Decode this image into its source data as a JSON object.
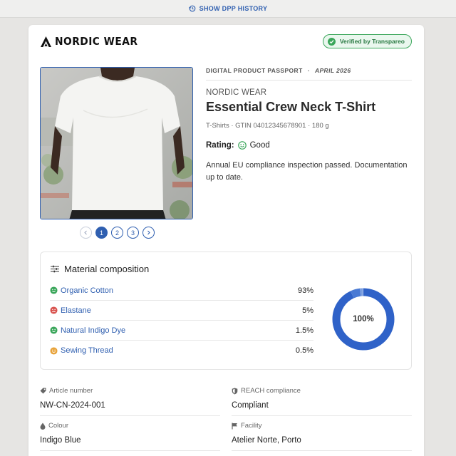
{
  "top_bar": {
    "history_label": "SHOW DPP HISTORY"
  },
  "brand": {
    "name": "NORDIC WEAR"
  },
  "badge": {
    "label": "Verified by Transpareo"
  },
  "gallery": {
    "pages": [
      "1",
      "2",
      "3"
    ],
    "active_page": "1"
  },
  "passport": {
    "eyebrow": "DIGITAL PRODUCT PASSPORT",
    "separator": "·",
    "date": "APRIL 2026",
    "brand": "NORDIC WEAR",
    "title": "Essential Crew Neck T-Shirt",
    "meta": "T-Shirts · GTIN 04012345678901 · 180 g",
    "rating_label": "Rating:",
    "rating_value": "Good",
    "description": "Annual EU compliance inspection passed. Documentation up to date."
  },
  "materials": {
    "title": "Material composition",
    "rows": [
      {
        "name": "Organic Cotton",
        "percent": "93%",
        "mood": "good"
      },
      {
        "name": "Elastane",
        "percent": "5%",
        "mood": "bad"
      },
      {
        "name": "Natural Indigo Dye",
        "percent": "1.5%",
        "mood": "good"
      },
      {
        "name": "Sewing Thread",
        "percent": "0.5%",
        "mood": "neutral"
      }
    ],
    "total_label": "100%",
    "donut_colors": [
      "#2f62c8",
      "#4a7ad4",
      "#7a9ee0",
      "#a9c0ec"
    ]
  },
  "details": [
    {
      "label": "Article number",
      "value": "NW-CN-2024-001",
      "icon": "tag-icon"
    },
    {
      "label": "REACH compliance",
      "value": "Compliant",
      "icon": "shield-icon"
    },
    {
      "label": "Colour",
      "value": "Indigo Blue",
      "icon": "droplet-icon"
    },
    {
      "label": "Facility",
      "value": "Atelier Norte, Porto",
      "icon": "flag-icon"
    }
  ],
  "colors": {
    "accent": "#2f5fb0",
    "good": "#3aa65a",
    "bad": "#d9534f",
    "neutral": "#e8a33a"
  }
}
